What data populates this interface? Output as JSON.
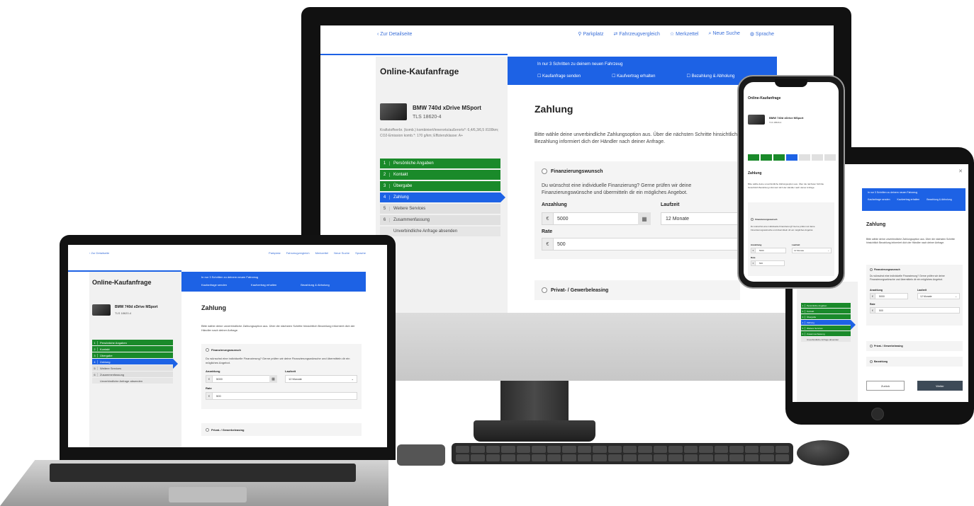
{
  "nav": {
    "back": "‹ Zur Detailseite",
    "links": [
      "Parkplatz",
      "Fahrzeugvergleich",
      "Merkzettel",
      "Neue Suche",
      "Sprache"
    ],
    "link_icons": [
      "parking-icon",
      "compare-icon",
      "bookmark-icon",
      "search-icon",
      "globe-icon"
    ]
  },
  "page": {
    "title": "Online-Kaufanfrage",
    "steps_intro": "In nur 3 Schritten zu deinem neuen Fahrzeug",
    "top_steps": [
      "Kaufanfrage senden",
      "Kaufvertrag erhalten",
      "Bezahlung & Abholung"
    ],
    "heading": "Zahlung",
    "intro": "Bitte wähle deine unverbindliche Zahlungsoption aus. Über die nächsten Schritte hinsichtlich Bezahlung informiert dich der Händler nach deiner Anfrage."
  },
  "vehicle": {
    "name": "BMW 740d xDrive MSport",
    "id": "TLS 18620-4",
    "desc": "Kraftstoffverbr. (komb.) kombiniert/innerorts/außerorts*: 6,4/6,3/6,5 l/100km; CO2-Emission komb.*: 170 g/km; Effizienzklasse: A+"
  },
  "steps": [
    {
      "num": "1",
      "label": "Persönliche Angaben",
      "state": "done"
    },
    {
      "num": "2",
      "label": "Kontakt",
      "state": "done"
    },
    {
      "num": "3",
      "label": "Übergabe",
      "state": "done"
    },
    {
      "num": "4",
      "label": "Zahlung",
      "state": "active"
    },
    {
      "num": "5",
      "label": "Weitere Services",
      "state": "todo"
    },
    {
      "num": "6",
      "label": "Zusammenfassung",
      "state": "todo"
    },
    {
      "num": "",
      "label": "Unverbindliche Anfrage absenden",
      "state": "plain"
    }
  ],
  "payment": {
    "finance_title": "Finanzierungswunsch",
    "finance_text": "Du wünschst eine individuelle Finanzierung? Gerne prüfen wir deine Finanzierungswünsche und übermitteln dir ein mögliches Angebot.",
    "down_label": "Anzahlung",
    "down_value": "5000",
    "currency": "€",
    "term_label": "Laufzeit",
    "term_value": "12 Monate",
    "rate_label": "Rate",
    "rate_value": "500",
    "leasing": "Privat- / Gewerbeleasing",
    "cash": "Barzahlung"
  },
  "buttons": {
    "back": "Zurück",
    "next": "Weiter"
  },
  "colors": {
    "accent": "#1d62e5",
    "done": "#1a8a2a"
  }
}
